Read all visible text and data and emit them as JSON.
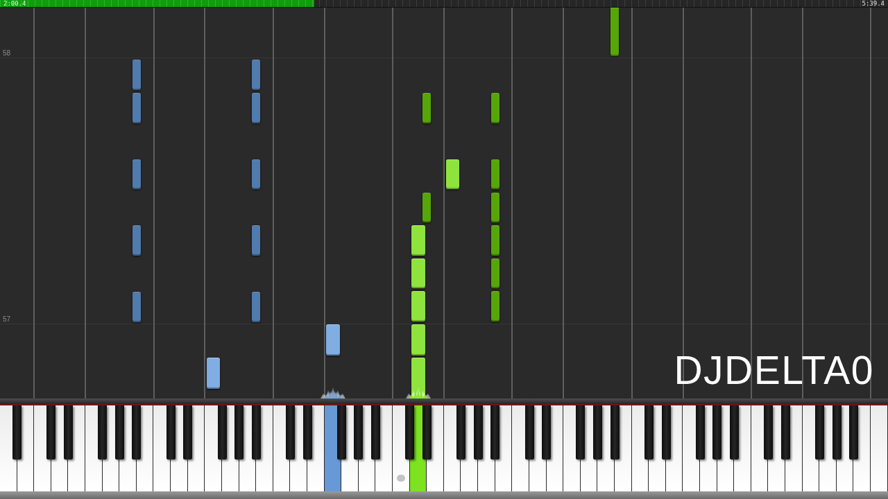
{
  "progress": {
    "elapsed": "2:00.4",
    "total": "5:39.4",
    "level": 0.354
  },
  "measure_lines": [
    {
      "label": "58"
    },
    {
      "label": "57"
    }
  ],
  "note_tracks": [
    {
      "color": "#80ade2"
    },
    {
      "color": "#8ee33c"
    }
  ],
  "overlay_text": "DJDELTA0",
  "keyboard": {
    "middle_c_dot": true,
    "keys": [
      {
        "kind": "white",
        "pressed": false
      },
      {
        "kind": "black",
        "pressed": false
      },
      {
        "kind": "white",
        "pressed": false
      },
      {
        "kind": "white",
        "pressed": false
      },
      {
        "kind": "black",
        "pressed": false
      },
      {
        "kind": "white",
        "pressed": false
      },
      {
        "kind": "black",
        "pressed": false
      },
      {
        "kind": "white",
        "pressed": false
      },
      {
        "kind": "white",
        "pressed": false
      },
      {
        "kind": "black",
        "pressed": false
      },
      {
        "kind": "white",
        "pressed": false
      },
      {
        "kind": "black",
        "pressed": false
      },
      {
        "kind": "white",
        "pressed": false
      },
      {
        "kind": "black",
        "pressed": false
      },
      {
        "kind": "white",
        "pressed": false
      },
      {
        "kind": "white",
        "pressed": false
      },
      {
        "kind": "black",
        "pressed": false
      },
      {
        "kind": "white",
        "pressed": false
      },
      {
        "kind": "black",
        "pressed": false
      },
      {
        "kind": "white",
        "pressed": false
      },
      {
        "kind": "white",
        "pressed": false
      },
      {
        "kind": "black",
        "pressed": false
      },
      {
        "kind": "white",
        "pressed": false
      },
      {
        "kind": "black",
        "pressed": false
      },
      {
        "kind": "white",
        "pressed": false
      },
      {
        "kind": "black",
        "pressed": false
      },
      {
        "kind": "white",
        "pressed": false
      },
      {
        "kind": "white",
        "pressed": false
      },
      {
        "kind": "black",
        "pressed": false
      },
      {
        "kind": "white",
        "pressed": false
      },
      {
        "kind": "black",
        "pressed": false
      },
      {
        "kind": "white",
        "pressed": false
      },
      {
        "kind": "white",
        "pressed": true,
        "color": "#6699d6"
      },
      {
        "kind": "black",
        "pressed": false
      },
      {
        "kind": "white",
        "pressed": false
      },
      {
        "kind": "black",
        "pressed": false
      },
      {
        "kind": "white",
        "pressed": false
      },
      {
        "kind": "black",
        "pressed": false
      },
      {
        "kind": "white",
        "pressed": false
      },
      {
        "kind": "white",
        "pressed": false
      },
      {
        "kind": "black",
        "pressed": false
      },
      {
        "kind": "white",
        "pressed": true,
        "color": "#7de21f"
      },
      {
        "kind": "black",
        "pressed": false
      },
      {
        "kind": "white",
        "pressed": false
      },
      {
        "kind": "white",
        "pressed": false
      },
      {
        "kind": "black",
        "pressed": false
      },
      {
        "kind": "white",
        "pressed": false
      },
      {
        "kind": "black",
        "pressed": false
      },
      {
        "kind": "white",
        "pressed": false
      },
      {
        "kind": "black",
        "pressed": false
      },
      {
        "kind": "white",
        "pressed": false
      },
      {
        "kind": "white",
        "pressed": false
      },
      {
        "kind": "black",
        "pressed": false
      },
      {
        "kind": "white",
        "pressed": false
      },
      {
        "kind": "black",
        "pressed": false
      },
      {
        "kind": "white",
        "pressed": false
      },
      {
        "kind": "white",
        "pressed": false
      },
      {
        "kind": "black",
        "pressed": false
      },
      {
        "kind": "white",
        "pressed": false
      },
      {
        "kind": "black",
        "pressed": false
      },
      {
        "kind": "white",
        "pressed": false
      },
      {
        "kind": "black",
        "pressed": false
      },
      {
        "kind": "white",
        "pressed": false
      },
      {
        "kind": "white",
        "pressed": false
      },
      {
        "kind": "black",
        "pressed": false
      },
      {
        "kind": "white",
        "pressed": false
      },
      {
        "kind": "black",
        "pressed": false
      },
      {
        "kind": "white",
        "pressed": false
      },
      {
        "kind": "white",
        "pressed": false
      },
      {
        "kind": "black",
        "pressed": false
      },
      {
        "kind": "white",
        "pressed": false
      },
      {
        "kind": "black",
        "pressed": false
      },
      {
        "kind": "white",
        "pressed": false
      },
      {
        "kind": "black",
        "pressed": false
      },
      {
        "kind": "white",
        "pressed": false
      },
      {
        "kind": "white",
        "pressed": false
      },
      {
        "kind": "black",
        "pressed": false
      },
      {
        "kind": "white",
        "pressed": false
      },
      {
        "kind": "black",
        "pressed": false
      },
      {
        "kind": "white",
        "pressed": false
      },
      {
        "kind": "white",
        "pressed": false
      },
      {
        "kind": "black",
        "pressed": false
      },
      {
        "kind": "white",
        "pressed": false
      },
      {
        "kind": "black",
        "pressed": false
      },
      {
        "kind": "white",
        "pressed": false
      },
      {
        "kind": "black",
        "pressed": false
      },
      {
        "kind": "white",
        "pressed": false
      },
      {
        "kind": "white",
        "pressed": false
      }
    ]
  }
}
